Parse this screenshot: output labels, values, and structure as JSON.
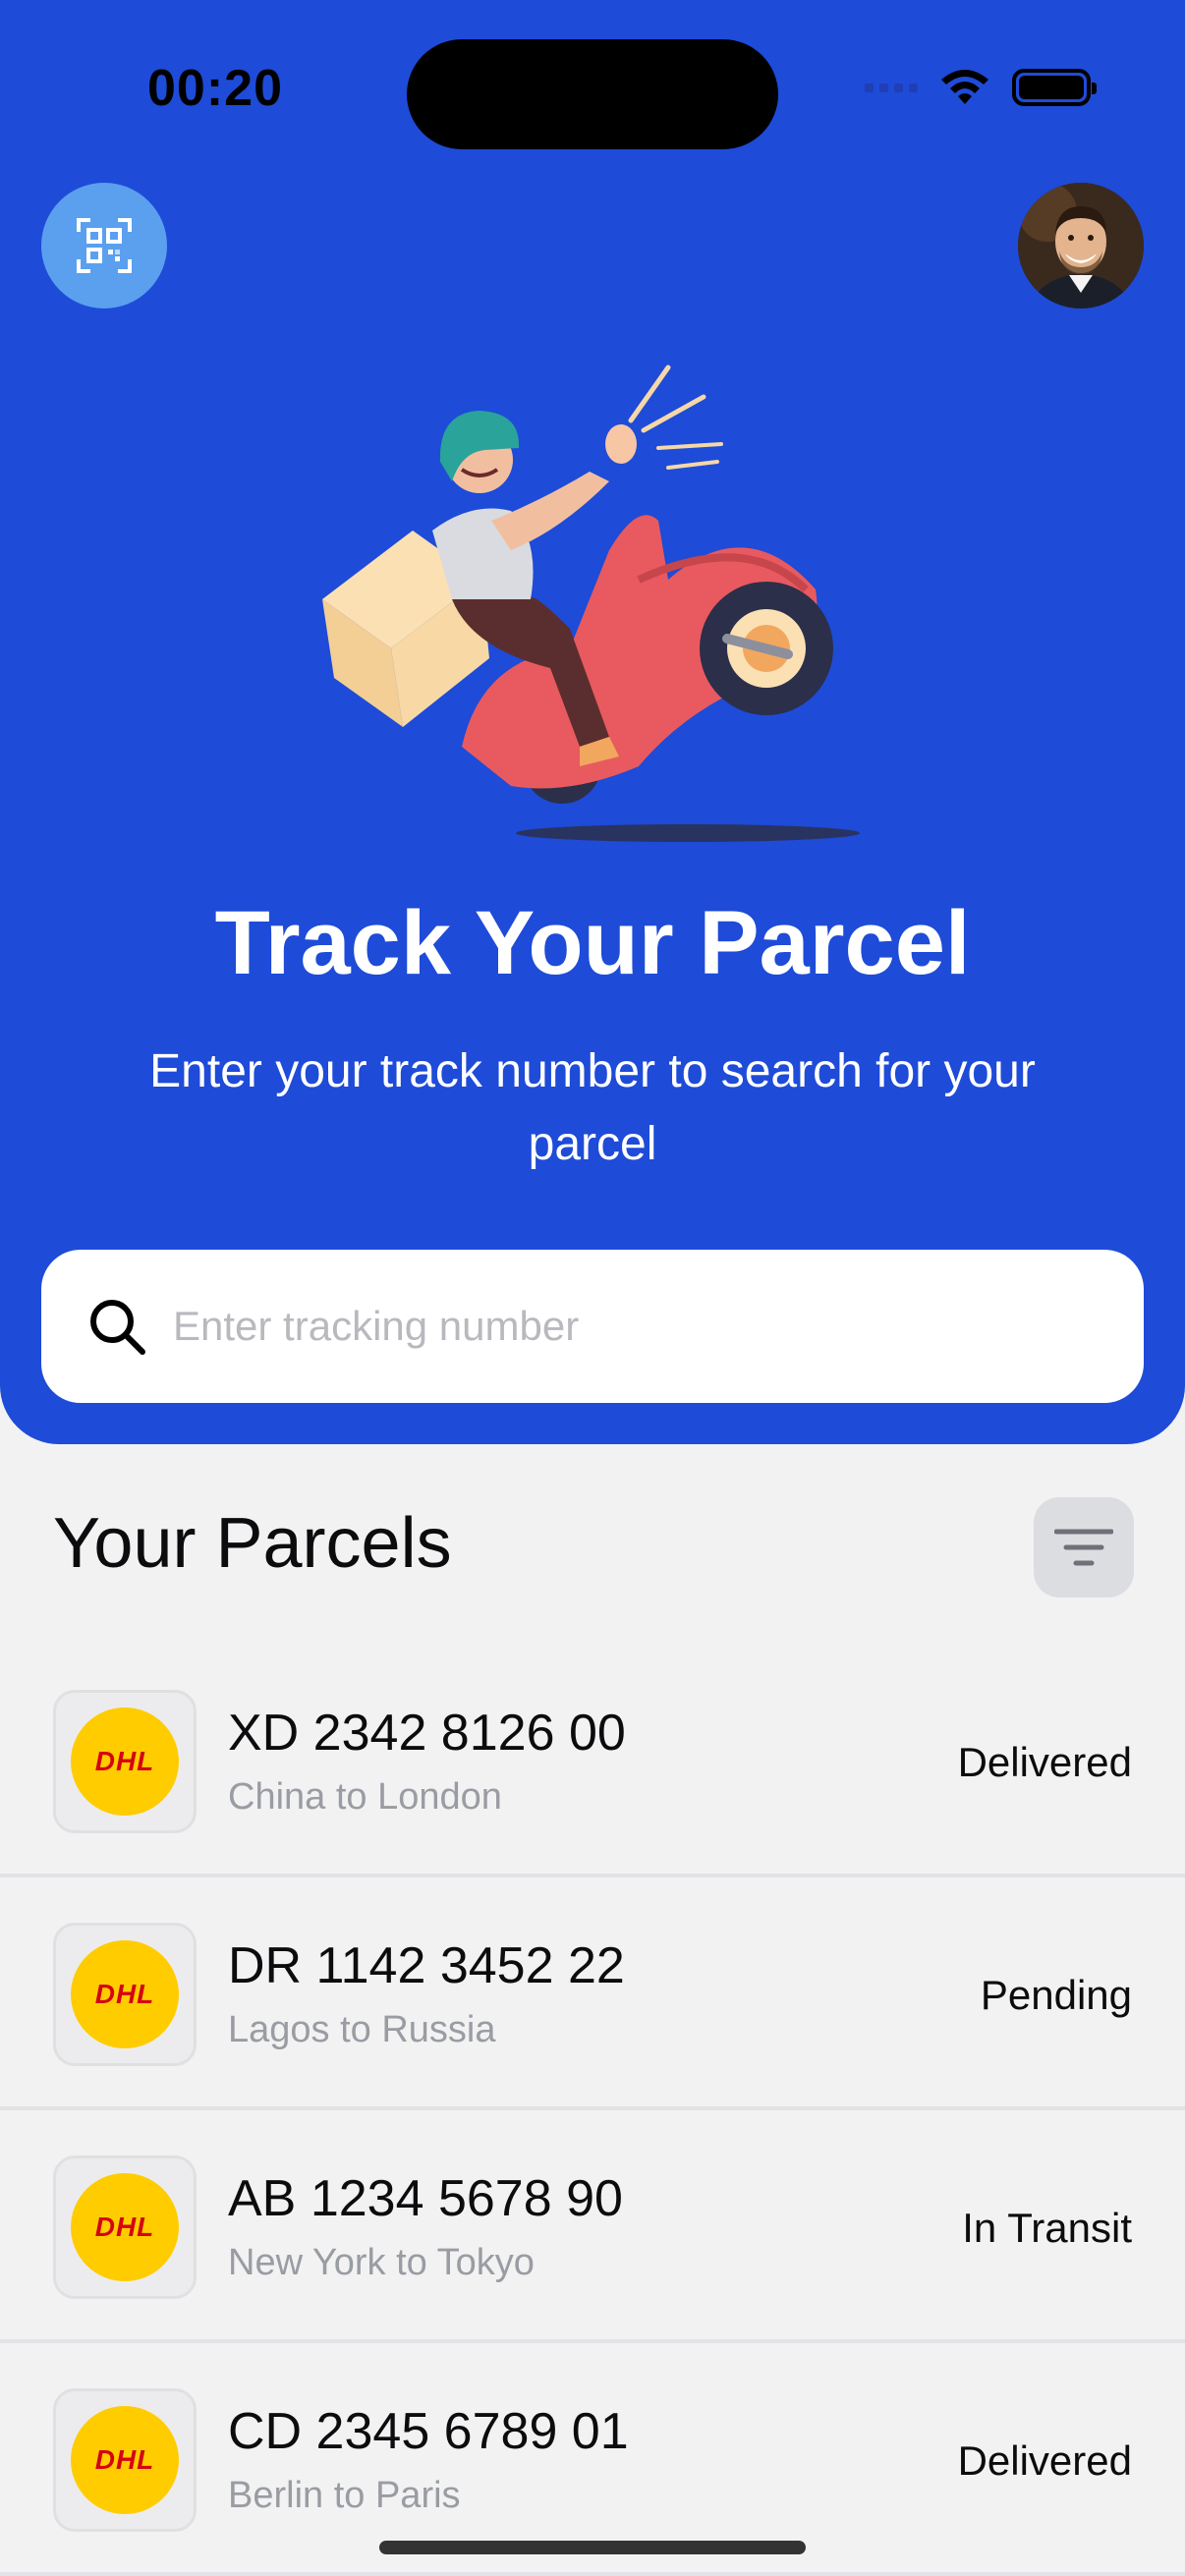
{
  "status_bar": {
    "time": "00:20"
  },
  "header": {
    "title": "Track Your Parcel",
    "subtitle": "Enter your track number to search for your parcel",
    "scan_icon": "qr-code-scan-icon",
    "avatar": "user-avatar"
  },
  "search": {
    "placeholder": "Enter tracking number",
    "value": ""
  },
  "parcels": {
    "title": "Your Parcels",
    "filter_icon": "filter-icon",
    "items": [
      {
        "carrier": "DHL",
        "tracking": "XD 2342 8126 00",
        "route": "China to London",
        "status": "Delivered"
      },
      {
        "carrier": "DHL",
        "tracking": "DR 1142 3452 22",
        "route": "Lagos to Russia",
        "status": "Pending"
      },
      {
        "carrier": "DHL",
        "tracking": "AB 1234 5678 90",
        "route": "New York to Tokyo",
        "status": "In Transit"
      },
      {
        "carrier": "DHL",
        "tracking": "CD 2345 6789 01",
        "route": "Berlin to Paris",
        "status": "Delivered"
      }
    ]
  },
  "colors": {
    "primary": "#1e4bd8",
    "background": "#f2f2f3",
    "dhl_yellow": "#ffcc00",
    "dhl_red": "#d40511"
  }
}
